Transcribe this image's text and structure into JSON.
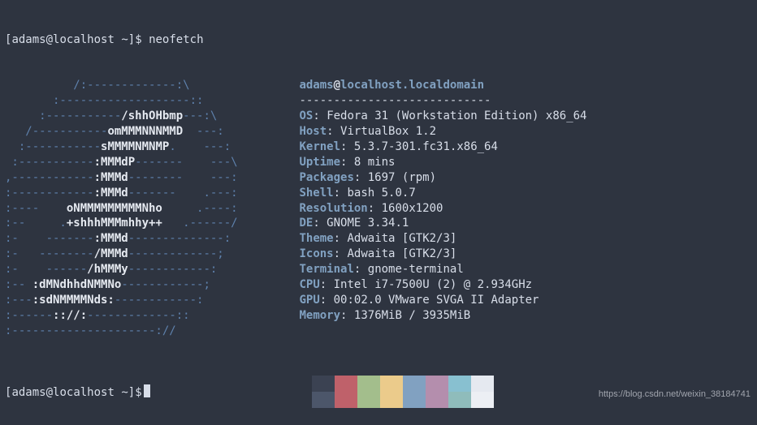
{
  "prompt": {
    "user": "adams",
    "host": "localhost",
    "path": "~",
    "command": "neofetch"
  },
  "neofetch": {
    "user": "adams",
    "at": "@",
    "host": "localhost.localdomain",
    "dashline": "----------------------------",
    "ascii": [
      {
        "b": "          /:-------------:\\"
      },
      {
        "b": "       :-------------------::"
      },
      {
        "b": "     :-----------",
        "w": "/shhOHbmp",
        "b2": "---:\\"
      },
      {
        "b": "   /-----------",
        "w": "omMMMNNNMMD  ",
        "b2": "---:"
      },
      {
        "b": "  :-----------",
        "w": "sMMMMNMNMP",
        "b2": ".    ---:"
      },
      {
        "b": " :-----------",
        "w": ":MMMdP",
        "b2": "-------    ---\\"
      },
      {
        "b": ",------------",
        "w": ":MMMd",
        "b2": "--------    ---:"
      },
      {
        "b": ":------------",
        "w": ":MMMd",
        "b2": "-------    .---:"
      },
      {
        "b": ":----    ",
        "w": "oNMMMMMMMMMNho",
        "b2": "     .----:"
      },
      {
        "b": ":--     .",
        "w": "+shhhMMMmhhy++",
        "b2": "   .------/"
      },
      {
        "b": ":-    -------",
        "w": ":MMMd",
        "b2": "--------------:"
      },
      {
        "b": ":-   --------",
        "w": "/MMMd",
        "b2": "-------------;"
      },
      {
        "b": ":-    ------",
        "w": "/hMMMy",
        "b2": "------------:"
      },
      {
        "b": ":--",
        "w": " :dMNdhhdNMMNo",
        "b2": "------------;"
      },
      {
        "b": ":---",
        "w": ":sdNMMMMNds:",
        "b2": "------------:"
      },
      {
        "b": ":------",
        "w": ":://:",
        "b2": "-------------::"
      },
      {
        "b": ":---------------------://"
      }
    ],
    "info": [
      {
        "label": "OS",
        "value": "Fedora 31 (Workstation Edition) x86_64"
      },
      {
        "label": "Host",
        "value": "VirtualBox 1.2"
      },
      {
        "label": "Kernel",
        "value": "5.3.7-301.fc31.x86_64"
      },
      {
        "label": "Uptime",
        "value": "8 mins"
      },
      {
        "label": "Packages",
        "value": "1697 (rpm)"
      },
      {
        "label": "Shell",
        "value": "bash 5.0.7"
      },
      {
        "label": "Resolution",
        "value": "1600x1200"
      },
      {
        "label": "DE",
        "value": "GNOME 3.34.1"
      },
      {
        "label": "Theme",
        "value": "Adwaita [GTK2/3]"
      },
      {
        "label": "Icons",
        "value": "Adwaita [GTK2/3]"
      },
      {
        "label": "Terminal",
        "value": "gnome-terminal"
      },
      {
        "label": "CPU",
        "value": "Intel i7-7500U (2) @ 2.934GHz"
      },
      {
        "label": "GPU",
        "value": "00:02.0 VMware SVGA II Adapter"
      },
      {
        "label": "Memory",
        "value": "1376MiB / 3935MiB"
      }
    ],
    "colors": {
      "row1": [
        "#3b4252",
        "#bf616a",
        "#a3be8c",
        "#ebcb8b",
        "#81a1c1",
        "#b48ead",
        "#88c0d0",
        "#e5e9f0"
      ],
      "row2": [
        "#4c566a",
        "#bf616a",
        "#a3be8c",
        "#ebcb8b",
        "#81a1c1",
        "#b48ead",
        "#8fbcbb",
        "#eceff4"
      ]
    }
  },
  "watermark": "https://blog.csdn.net/weixin_38184741"
}
